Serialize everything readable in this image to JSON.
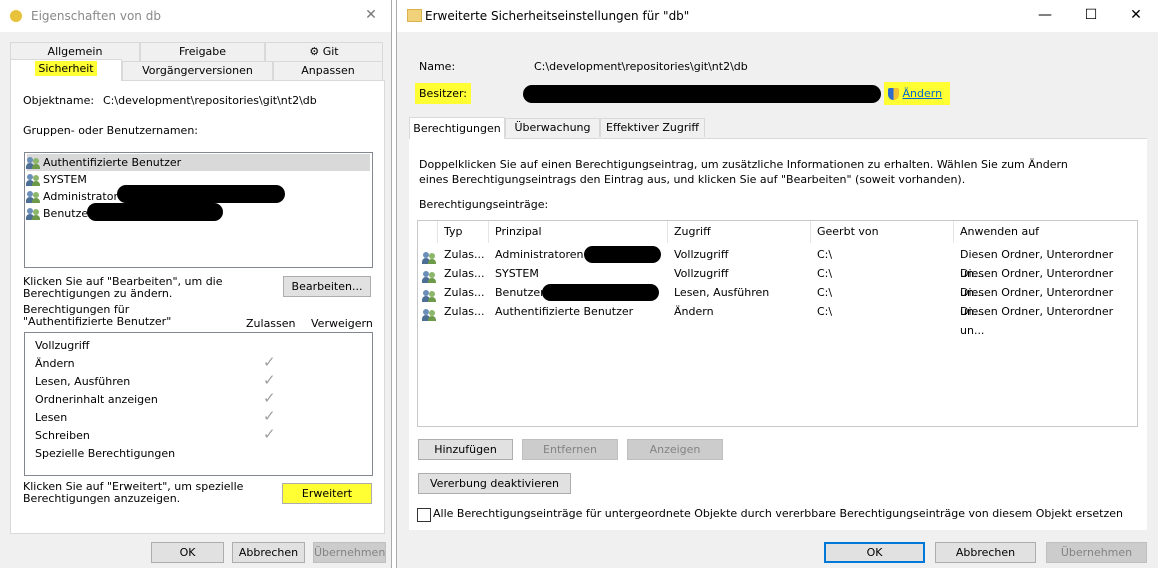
{
  "left": {
    "title": "Eigenschaften von db",
    "tabs_row1": [
      "Allgemein",
      "Freigabe",
      "Git"
    ],
    "tabs_row2": [
      "Sicherheit",
      "Vorgängerversionen",
      "Anpassen"
    ],
    "object_label": "Objektname:",
    "object_value": "C:\\development\\repositories\\git\\nt2\\db",
    "groups_label": "Gruppen- oder Benutzernamen:",
    "users": [
      "Authentifizierte Benutzer",
      "SYSTEM",
      "Administratoren",
      "Benutze"
    ],
    "edit_hint": "Klicken Sie auf \"Bearbeiten\", um die Berechtigungen zu ändern.",
    "edit_button": "Bearbeiten...",
    "perm_for": "Berechtigungen für \"Authentifizierte Benutzer\"",
    "allow_header": "Zulassen",
    "deny_header": "Verweigern",
    "permissions": [
      "Vollzugriff",
      "Ändern",
      "Lesen, Ausführen",
      "Ordnerinhalt anzeigen",
      "Lesen",
      "Schreiben",
      "Spezielle Berechtigungen"
    ],
    "advanced_hint": "Klicken Sie auf \"Erweitert\", um spezielle Berechtigungen anzuzeigen.",
    "advanced_button": "Erweitert",
    "ok": "OK",
    "cancel": "Abbrechen",
    "apply": "Übernehmen"
  },
  "right": {
    "title": "Erweiterte Sicherheitseinstellungen für \"db\"",
    "name_label": "Name:",
    "name_value": "C:\\development\\repositories\\git\\nt2\\db",
    "owner_label": "Besitzer:",
    "change_link": "Ändern",
    "tabs": [
      "Berechtigungen",
      "Überwachung",
      "Effektiver Zugriff"
    ],
    "info": "Doppelklicken Sie auf einen Berechtigungseintrag, um zusätzliche Informationen zu erhalten. Wählen Sie zum Ändern eines Berechtigungseintrags den Eintrag aus, und klicken Sie auf \"Bearbeiten\" (soweit vorhanden).",
    "entries_label": "Berechtigungseinträge:",
    "columns": [
      "Typ",
      "Prinzipal",
      "Zugriff",
      "Geerbt von",
      "Anwenden auf"
    ],
    "rows": [
      {
        "type": "Zulas...",
        "principal": "Administratoren",
        "access": "Vollzugriff",
        "inherited": "C:\\",
        "apply": "Diesen Ordner, Unterordner un..."
      },
      {
        "type": "Zulas...",
        "principal": "SYSTEM",
        "access": "Vollzugriff",
        "inherited": "C:\\",
        "apply": "Diesen Ordner, Unterordner un..."
      },
      {
        "type": "Zulas...",
        "principal": "Benutzer",
        "access": "Lesen, Ausführen",
        "inherited": "C:\\",
        "apply": "Diesen Ordner, Unterordner un..."
      },
      {
        "type": "Zulas...",
        "principal": "Authentifizierte Benutzer",
        "access": "Ändern",
        "inherited": "C:\\",
        "apply": "Diesen Ordner, Unterordner un..."
      }
    ],
    "add_button": "Hinzufügen",
    "remove_button": "Entfernen",
    "view_button": "Anzeigen",
    "inherit_button": "Vererbung deaktivieren",
    "replace_checkbox": "Alle Berechtigungseinträge für untergeordnete Objekte durch vererbbare Berechtigungseinträge von diesem Objekt ersetzen",
    "ok": "OK",
    "cancel": "Abbrechen",
    "apply": "Übernehmen"
  },
  "colors": {
    "highlight": "#ffff33",
    "focus": "#0078d7"
  }
}
